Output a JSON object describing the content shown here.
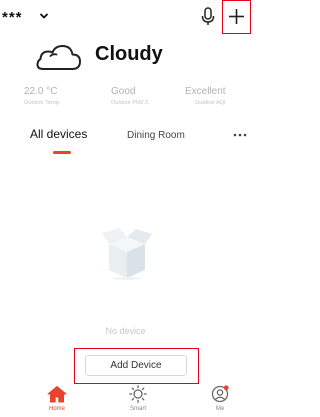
{
  "header": {
    "home_name": "***",
    "chevron_icon": "chevron-down-icon",
    "mic_icon": "microphone-icon",
    "add_icon": "plus-icon"
  },
  "weather": {
    "icon": "cloud-icon",
    "label": "Cloudy",
    "stats": [
      {
        "value": "22.0 °C",
        "label": "Outdoor Temp."
      },
      {
        "value": "Good",
        "label": "Outdoor PM2.5"
      },
      {
        "value": "Excellent",
        "label": "Outdoor AQI"
      }
    ]
  },
  "tabs": {
    "items": [
      {
        "label": "All devices",
        "active": true
      },
      {
        "label": "Dining Room",
        "active": false
      }
    ],
    "more_icon": "more-horizontal-icon"
  },
  "empty_state": {
    "icon": "empty-box-icon",
    "text": "No device",
    "button_label": "Add Device"
  },
  "bottom_nav": {
    "items": [
      {
        "label": "Home",
        "icon": "home-icon",
        "active": true
      },
      {
        "label": "Smart",
        "icon": "sun-icon",
        "active": false
      },
      {
        "label": "Me",
        "icon": "user-icon",
        "active": false
      }
    ]
  },
  "colors": {
    "accent": "#e8432e",
    "highlight_border": "#e3001b",
    "muted_text": "#b2b2b2"
  }
}
